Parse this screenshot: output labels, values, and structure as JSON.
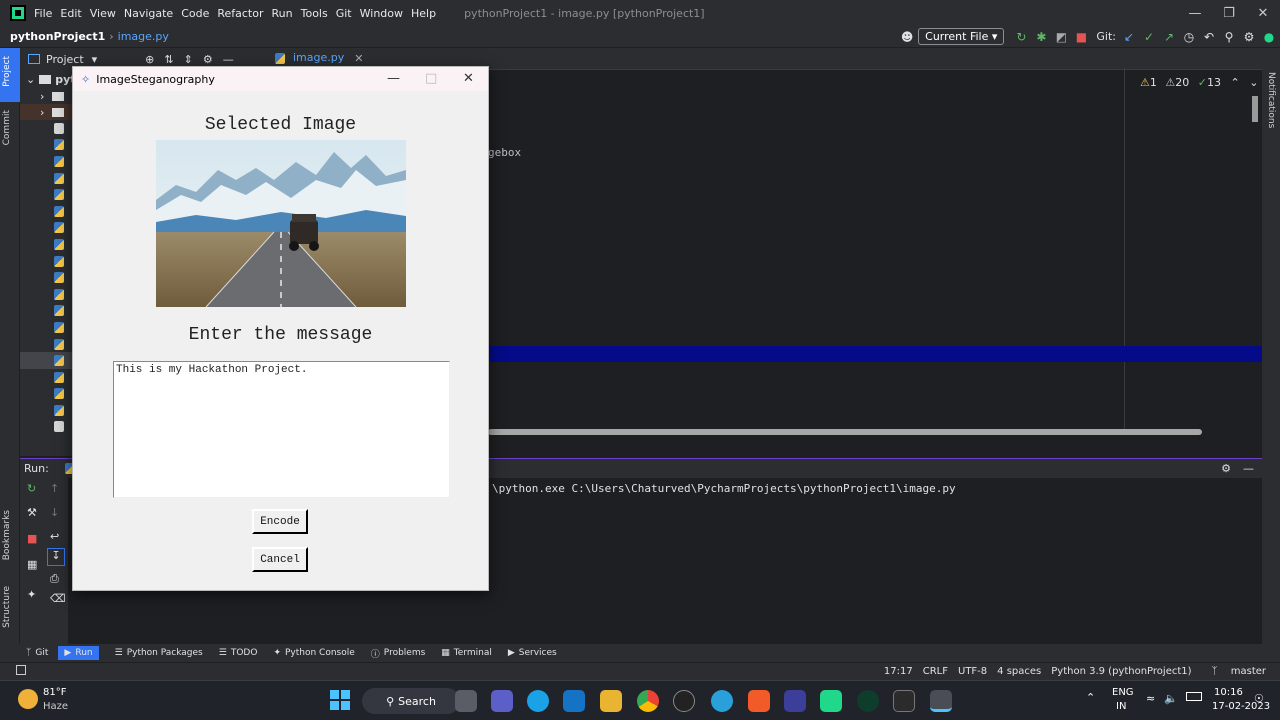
{
  "menubar": {
    "items": [
      "File",
      "Edit",
      "View",
      "Navigate",
      "Code",
      "Refactor",
      "Run",
      "Tools",
      "Git",
      "Window",
      "Help"
    ],
    "window_title": "pythonProject1 - image.py [pythonProject1]"
  },
  "toolbar": {
    "project": "pythonProject1",
    "file": "image.py",
    "run_config": "Current File",
    "git_label": "Git:"
  },
  "project_panel": {
    "title": "Project",
    "root": "pyt"
  },
  "side_labels": {
    "project": "Project",
    "commit": "Commit",
    "bookmarks": "Bookmarks",
    "structure": "Structure",
    "notifications": "Notifications"
  },
  "editor": {
    "tab": "image.py",
    "visible_code": "gebox",
    "warnings": "1",
    "weak_warnings": "20",
    "typos": "13"
  },
  "run_panel": {
    "title": "Run:",
    "console_line": "\\python.exe C:\\Users\\Chaturved\\PycharmProjects\\pythonProject1\\image.py"
  },
  "bottom_tabs": [
    "Git",
    "Run",
    "Python Packages",
    "TODO",
    "Python Console",
    "Problems",
    "Terminal",
    "Services"
  ],
  "status": {
    "position": "17:17",
    "line_sep": "CRLF",
    "encoding": "UTF-8",
    "indent": "4 spaces",
    "interpreter": "Python 3.9 (pythonProject1)",
    "branch": "master"
  },
  "dialog": {
    "title": "ImageSteganography",
    "selected_label": "Selected Image",
    "message_label": "Enter the message",
    "message_value": "This is my Hackathon Project.",
    "encode_button": "Encode",
    "cancel_button": "Cancel"
  },
  "taskbar": {
    "weather_temp": "81°F",
    "weather_desc": "Haze",
    "search": "Search",
    "lang": "ENG",
    "region": "IN",
    "time": "10:16",
    "date": "17-02-2023"
  },
  "colors": {
    "ide_bg": "#1e1f22",
    "panel_bg": "#2b2d30",
    "accent": "#3574f0",
    "selection_line": "#050a88"
  }
}
